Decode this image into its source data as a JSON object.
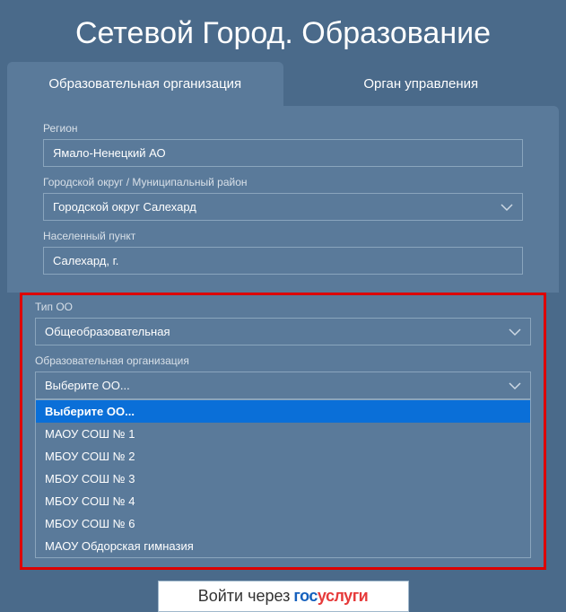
{
  "title": "Сетевой Город. Образование",
  "tabs": {
    "org": "Образовательная организация",
    "mgmt": "Орган управления"
  },
  "fields": {
    "region": {
      "label": "Регион",
      "value": "Ямало-Ненецкий АО"
    },
    "district": {
      "label": "Городской округ / Муниципальный район",
      "value": "Городской округ Салехард"
    },
    "settlement": {
      "label": "Населенный пункт",
      "value": "Салехард, г."
    },
    "ootype": {
      "label": "Тип ОО",
      "value": "Общеобразовательная"
    },
    "org": {
      "label": "Образовательная организация",
      "value": "Выберите ОО..."
    }
  },
  "dropdown": {
    "items": [
      "Выберите ОО...",
      "МАОУ СОШ № 1",
      "МБОУ СОШ № 2",
      "МБОУ СОШ № 3",
      "МБОУ СОШ № 4",
      "МБОУ СОШ № 6",
      "МАОУ Обдорская гимназия"
    ]
  },
  "login": {
    "pre": "Войти через",
    "gos": "госуслуги"
  }
}
